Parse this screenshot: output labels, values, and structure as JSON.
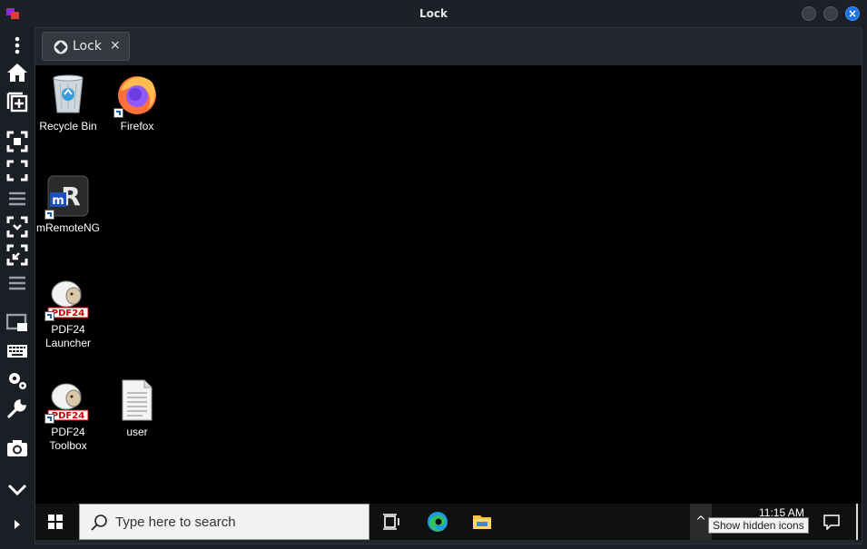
{
  "window": {
    "title": "Lock"
  },
  "sidebar": {
    "items": [
      {
        "name": "more-menu-icon"
      },
      {
        "name": "home-icon"
      },
      {
        "name": "new-tab-icon"
      },
      {
        "name": "fit-screen-icon"
      },
      {
        "name": "fullscreen-icon"
      },
      {
        "name": "menu-lines-icon"
      },
      {
        "name": "scale-screen-icon"
      },
      {
        "name": "zoom-screen-icon"
      },
      {
        "name": "menu-lines-2-icon"
      },
      {
        "name": "display-icon"
      },
      {
        "name": "keyboard-icon"
      },
      {
        "name": "settings-gears-icon"
      },
      {
        "name": "wrench-icon"
      },
      {
        "name": "camera-icon"
      },
      {
        "name": "chevron-down-icon"
      },
      {
        "name": "expand-right-icon"
      }
    ]
  },
  "tab": {
    "label": "Lock",
    "close": "×"
  },
  "desktop": {
    "icons": [
      {
        "label": "Recycle Bin"
      },
      {
        "label": "Firefox"
      },
      {
        "label": "mRemoteNG"
      },
      {
        "label": "PDF24\nLauncher"
      },
      {
        "label": "PDF24\nToolbox"
      },
      {
        "label": "user"
      }
    ]
  },
  "taskbar": {
    "search_placeholder": "Type here to search",
    "clock_time": "11:15 AM",
    "tooltip": "Show hidden icons",
    "tray_arrow": "^"
  },
  "colors": {
    "accent": "#1a73e8",
    "desktop": "#000000",
    "taskbar": "#101010"
  }
}
